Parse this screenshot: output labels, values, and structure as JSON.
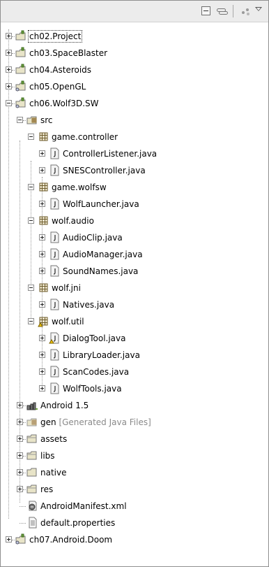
{
  "toolbar": {
    "collapse_all": "collapse-all-icon",
    "link_with_editor": "link-with-editor-icon",
    "view_options": "view-options-icon",
    "view_menu": "view-menu-icon"
  },
  "tree": {
    "p1": "ch02.Project",
    "p2": "ch03.SpaceBlaster",
    "p3": "ch04.Asteroids",
    "p4": "ch05.OpenGL",
    "p5": "ch06.Wolf3D.SW",
    "src": "src",
    "pk1": "game.controller",
    "f1": "ControllerListener.java",
    "f2": "SNESController.java",
    "pk2": "game.wolfsw",
    "f3": "WolfLauncher.java",
    "pk3": "wolf.audio",
    "f4": "AudioClip.java",
    "f5": "AudioManager.java",
    "f6": "SoundNames.java",
    "pk4": "wolf.jni",
    "f7": "Natives.java",
    "pk5": "wolf.util",
    "f8": "DialogTool.java",
    "f9": "LibraryLoader.java",
    "f10": "ScanCodes.java",
    "f11": "WolfTools.java",
    "lib": "Android 1.5",
    "gen": "gen",
    "gen_decor": "[Generated Java Files]",
    "assets": "assets",
    "libs": "libs",
    "native": "native",
    "res": "res",
    "manifest": "AndroidManifest.xml",
    "props": "default.properties",
    "p6": "ch07.Android.Doom"
  }
}
